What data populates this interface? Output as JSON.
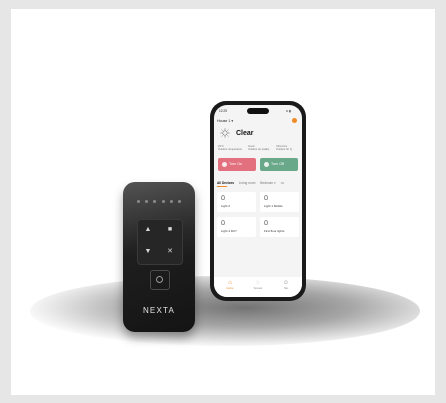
{
  "colors": {
    "accent": "#f08a24",
    "turn_on": "#e2707e",
    "turn_off": "#6aa88a",
    "remote_body": "#1f1f1f"
  },
  "remote": {
    "brand": "NEXTA",
    "sub_brand": "· · · ·"
  },
  "phone": {
    "status_time": "12:25",
    "status_right": "•• ▮",
    "home_selector": "House 1 ▾",
    "weather": {
      "icon": "sun-icon",
      "condition": "Clear"
    },
    "stats": [
      {
        "value": "25°C",
        "label": "Outdoor temperature"
      },
      {
        "value": "Good",
        "label": "Outdoor air quality"
      },
      {
        "value": "Ultra Fine",
        "label": "Outdoor Air Q"
      }
    ],
    "buttons": {
      "turn_on": "Turn On",
      "turn_off": "Turn Off"
    },
    "tabs": [
      "All Devices",
      "Living room",
      "Bedroom ▾",
      "•••"
    ],
    "devices": [
      "Light 2",
      "Light 1 Mobile",
      "Light 4 DC7",
      "First floor lights"
    ],
    "nav": [
      {
        "icon": "home-icon",
        "label": "Home"
      },
      {
        "icon": "scene-icon",
        "label": "Scenes"
      },
      {
        "icon": "profile-icon",
        "label": "Me"
      }
    ]
  }
}
